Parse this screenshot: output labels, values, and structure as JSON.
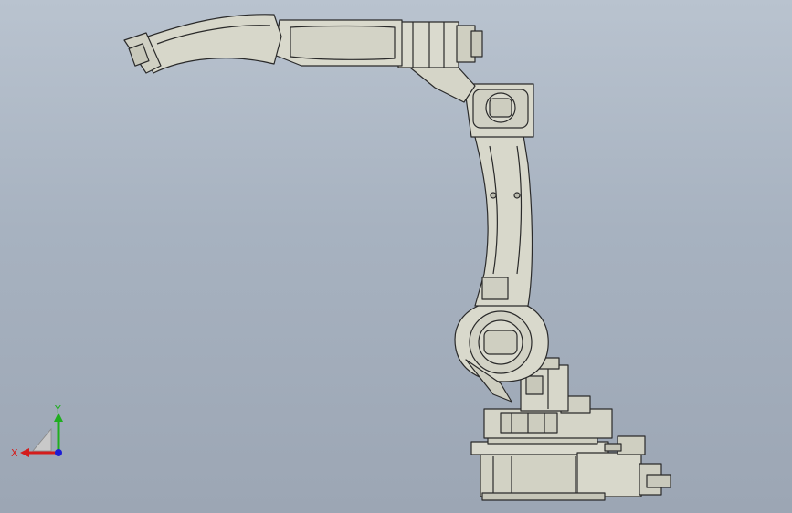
{
  "viewport": {
    "background_top": "#b9c3cf",
    "background_bottom": "#9ca6b4",
    "model_color": "#d6d6c9",
    "edge_color": "#2a2a2a"
  },
  "model": {
    "name": "",
    "parts": [
      "base",
      "turntable",
      "servo-motor-j1",
      "lower-arm",
      "shoulder-joint",
      "elbow-joint",
      "upper-arm",
      "wrist",
      "end-flange"
    ]
  },
  "triad": {
    "x_label": "X",
    "y_label": "Y",
    "x_color": "#d41c1c",
    "y_color": "#1fae1f",
    "z_color": "#1c1cd4"
  }
}
